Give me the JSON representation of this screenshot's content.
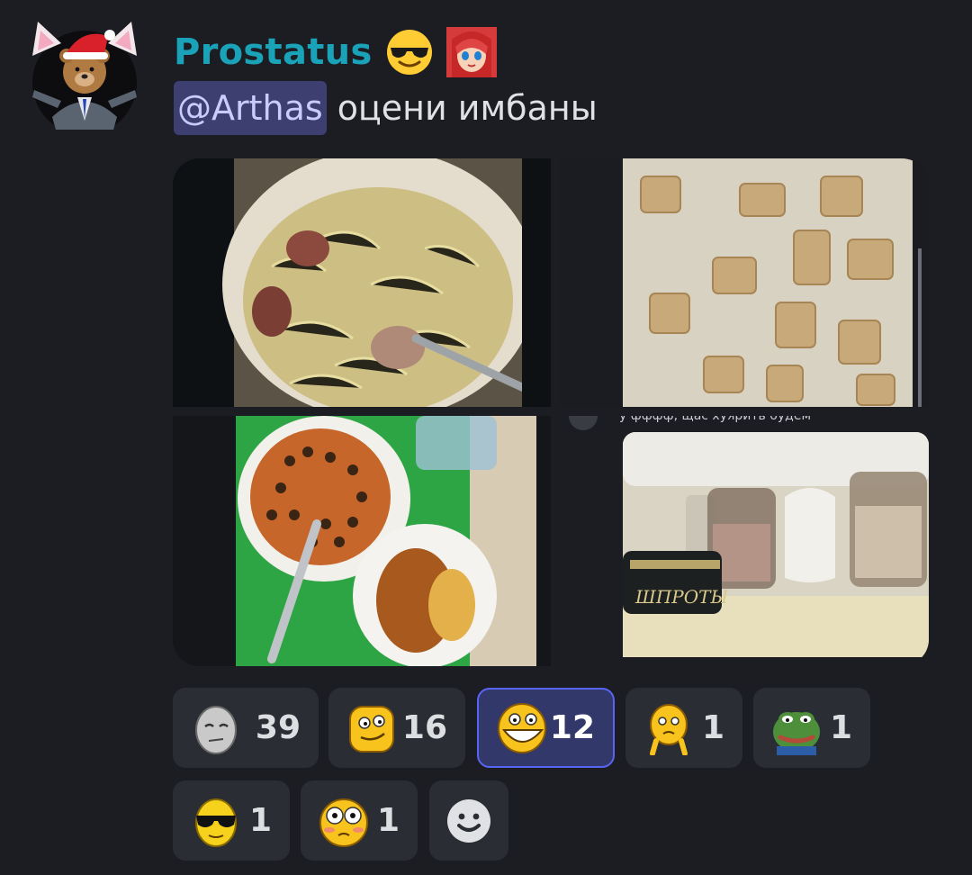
{
  "author": {
    "name": "Prostatus",
    "badges": [
      "sunglasses-emoji",
      "anime-girl-badge"
    ]
  },
  "message": {
    "mention": "@Arthas",
    "text": "оцени имбаны"
  },
  "attachments": {
    "count": 4,
    "items": [
      "sauerkraut-stew-photo",
      "potato-porridge-photo",
      "soup-and-cutlet-tray-photo",
      "fridge-jars-screenshot"
    ],
    "embedded_text": {
      "caption_snippet": "у фффф, щас хуярить будем",
      "can_label": "ШПРОТЫ"
    }
  },
  "reactions": [
    {
      "icon": "grey-meme-face",
      "count": "39",
      "active": false
    },
    {
      "icon": "yellow-smug-face",
      "count": "16",
      "active": false
    },
    {
      "icon": "yellow-grin-face",
      "count": "12",
      "active": true
    },
    {
      "icon": "yellow-doubt-face",
      "count": "1",
      "active": false
    },
    {
      "icon": "pepe-frog",
      "count": "1",
      "active": false
    },
    {
      "icon": "sunglasses-face",
      "count": "1",
      "active": false
    },
    {
      "icon": "flushed-face",
      "count": "1",
      "active": false
    },
    {
      "icon": "add-reaction",
      "count": "",
      "active": false
    }
  ],
  "colors": {
    "background": "#1c1d23",
    "username": "#1aa3b8",
    "mention_bg": "#3d3f70",
    "reaction_bg": "#2b2d34",
    "reaction_active_border": "#5865f2"
  }
}
